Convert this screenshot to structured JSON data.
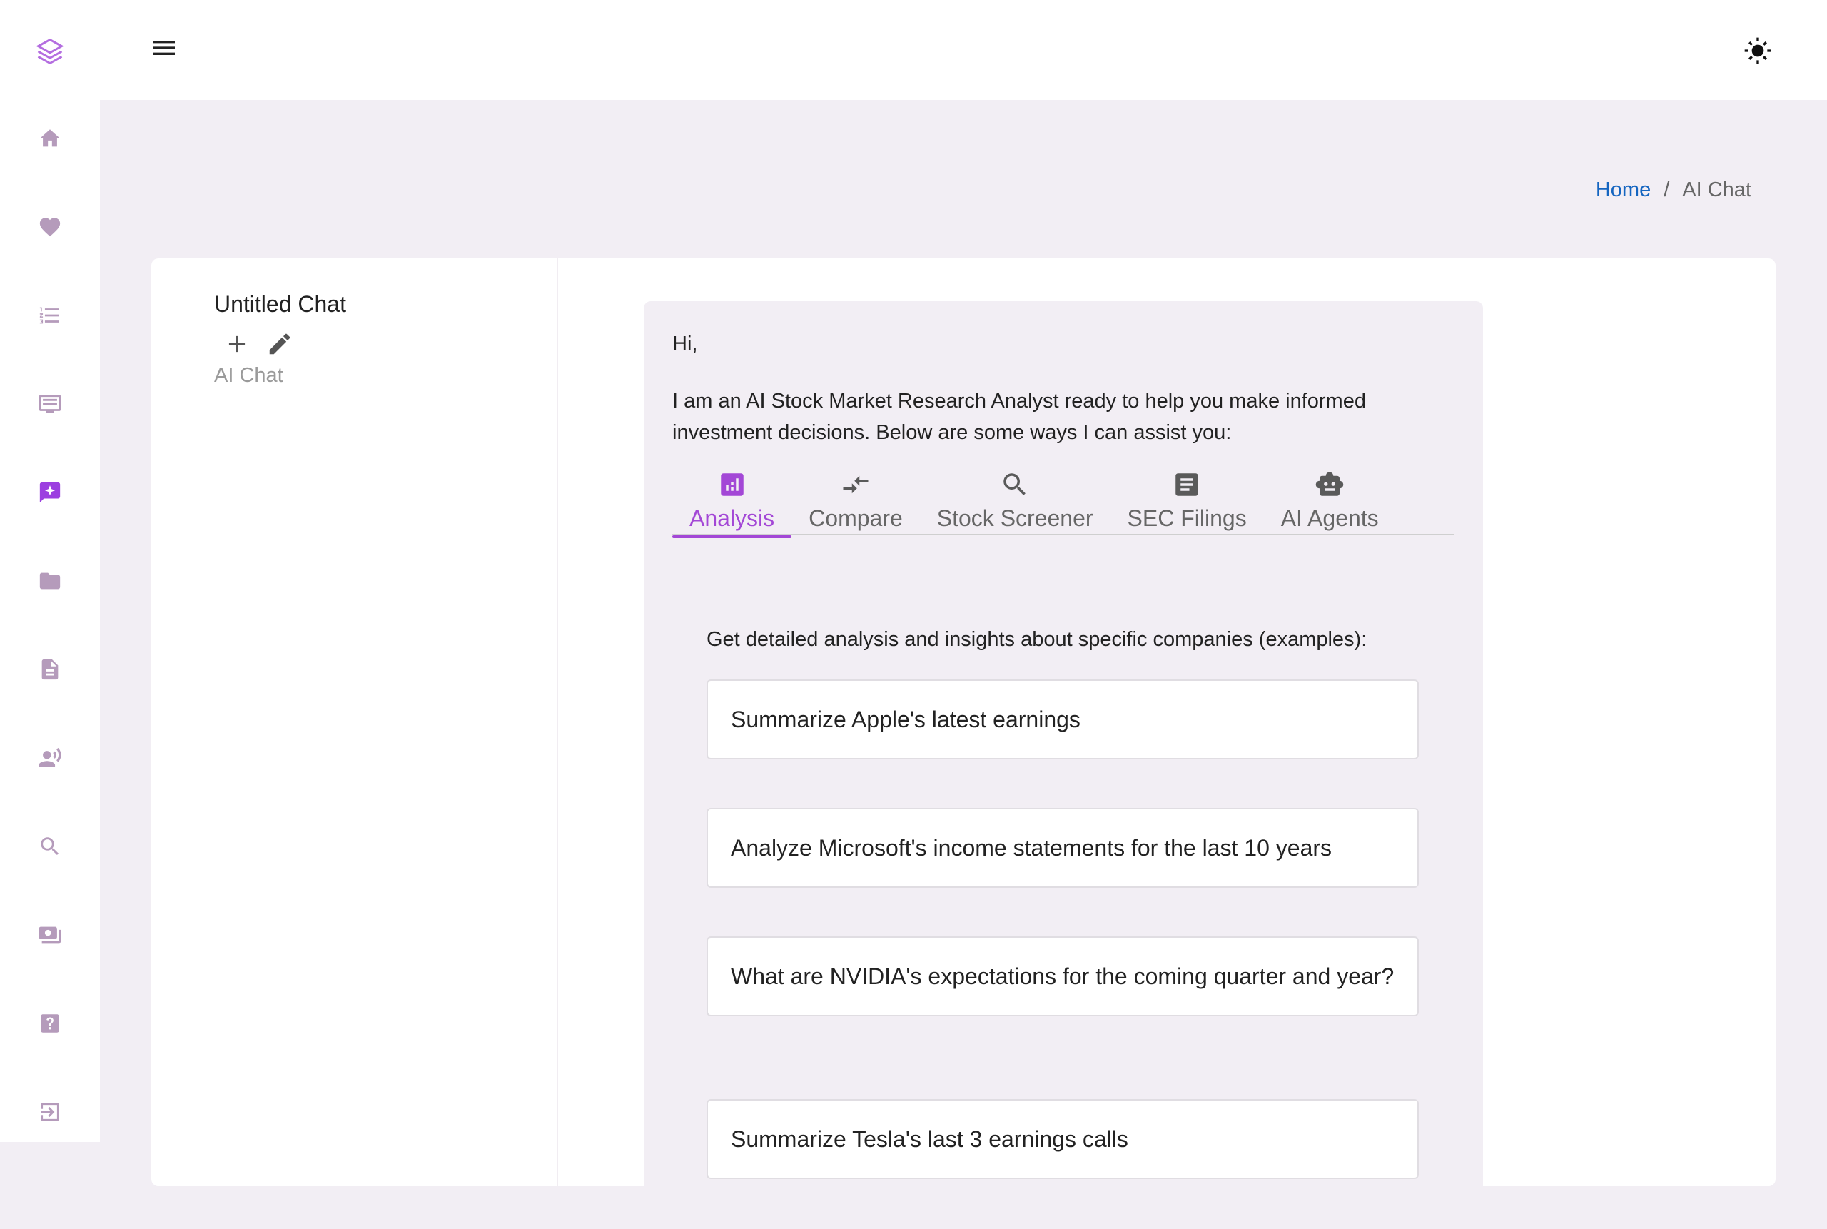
{
  "sidebar": {
    "icons": [
      "logo-icon",
      "home-icon",
      "heart-icon",
      "list-icon",
      "screen-icon",
      "ai-chat-icon",
      "folder-icon",
      "document-icon",
      "voice-icon",
      "search-icon",
      "money-icon",
      "help-icon",
      "logout-icon"
    ],
    "active": "ai-chat-icon",
    "accent": "#9c3fe0"
  },
  "header": {
    "theme_icon": "sun-icon"
  },
  "breadcrumb": {
    "home": "Home",
    "separator": "/",
    "current": "AI Chat"
  },
  "chat_side": {
    "title": "Untitled Chat",
    "subtitle": "AI Chat"
  },
  "chat": {
    "greeting": "Hi,",
    "intro": "I am an AI Stock Market Research Analyst ready to help you make informed investment decisions. Below are some ways I can assist you:",
    "tabs": [
      {
        "label": "Analysis",
        "icon": "bar-chart-icon",
        "active": true
      },
      {
        "label": "Compare",
        "icon": "compare-arrows-icon",
        "active": false
      },
      {
        "label": "Stock Screener",
        "icon": "search-icon",
        "active": false
      },
      {
        "label": "SEC Filings",
        "icon": "document-icon",
        "active": false
      },
      {
        "label": "AI Agents",
        "icon": "robot-icon",
        "active": false
      }
    ],
    "description": "Get detailed analysis and insights about specific companies (examples):",
    "examples": [
      "Summarize Apple's latest earnings",
      "Analyze Microsoft's income statements for the last 10 years",
      "What are NVIDIA's expectations for the coming quarter and year?",
      "Summarize Tesla's last 3 earnings calls"
    ]
  }
}
